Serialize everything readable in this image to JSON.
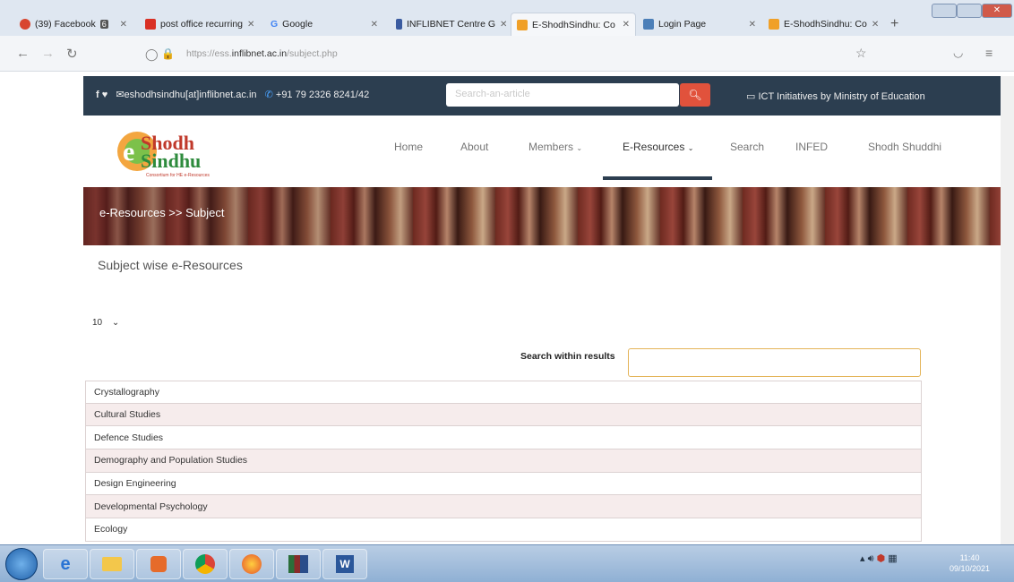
{
  "browser": {
    "tabs": [
      {
        "label": "(39) Facebook",
        "badge": "6",
        "color": "#d8452f"
      },
      {
        "label": "post office recurring",
        "color": "#d93025"
      },
      {
        "label": "Google",
        "color": "#4285f4"
      },
      {
        "label": "INFLIBNET Centre G",
        "color": "#3a5ba0"
      },
      {
        "label": "E-ShodhSindhu: Co",
        "color": "#f0a028"
      },
      {
        "label": "Login Page",
        "color": "#4c7fb8"
      },
      {
        "label": "E-ShodhSindhu: Co",
        "color": "#f0a028"
      }
    ],
    "url_prefix": "https://ess.",
    "url_domain": "inflibnet.ac.in",
    "url_path": "/subject.php"
  },
  "topbar": {
    "email": "eshodhsindhu[at]inflibnet.ac.in",
    "phone": "+91 79 2326 8241/42",
    "search_placeholder": "Search-an-article",
    "ict": "ICT Initiatives by Ministry of Education"
  },
  "logo": {
    "text_top": "Shodh",
    "text_bottom": "Sindhu",
    "prefix": "e",
    "tagline": "Consortium for HE e-Resources"
  },
  "nav": {
    "home": "Home",
    "about": "About",
    "members": "Members",
    "eresources": "E-Resources",
    "search": "Search",
    "infed": "INFED",
    "shodh": "Shodh Shuddhi"
  },
  "banner": {
    "breadcrumb": "e-Resources >> Subject"
  },
  "main": {
    "title": "Subject wise e-Resources",
    "per_page": "10",
    "search_label": "Search within results",
    "rows": [
      "Crystallography",
      "Cultural Studies",
      "Defence Studies",
      "Demography and Population Studies",
      "Design Engineering",
      "Developmental Psychology",
      "Ecology"
    ]
  },
  "taskbar": {
    "time": "11:40",
    "date": "09/10/2021"
  }
}
